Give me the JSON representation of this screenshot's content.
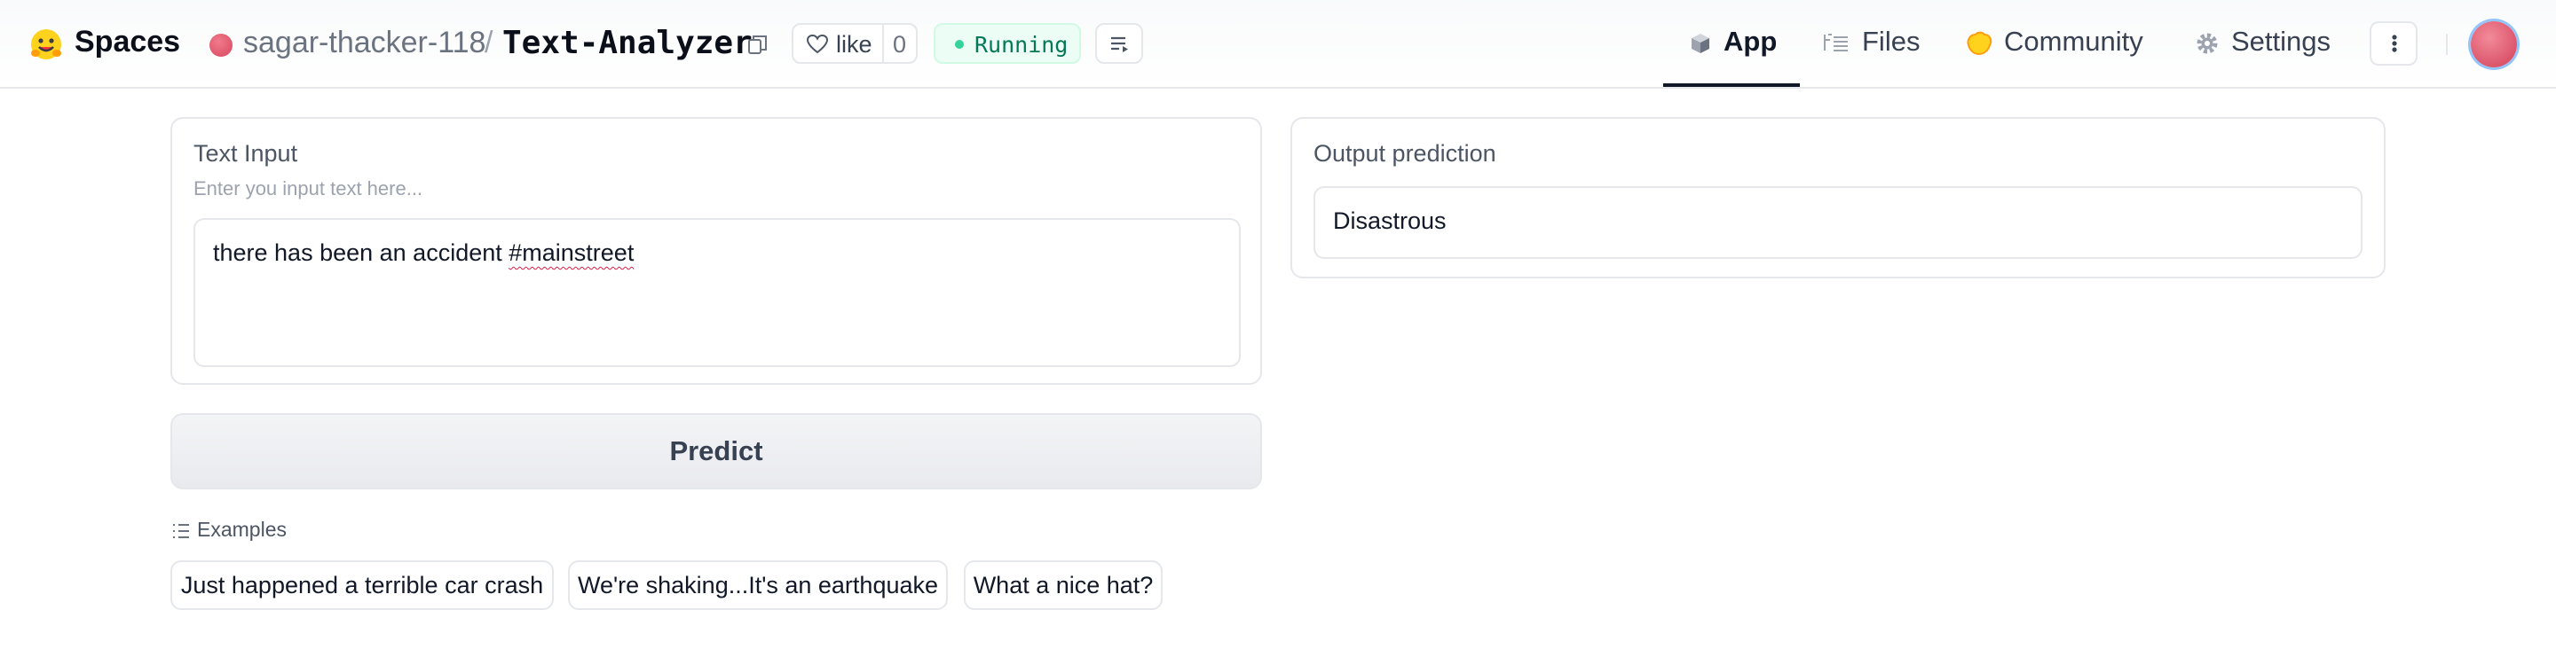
{
  "header": {
    "site_name": "Spaces",
    "owner": "sagar-thacker-118",
    "separator": "/",
    "repo": "Text-Analyzer",
    "like_label": "like",
    "like_count": "0",
    "status": "Running",
    "tabs": [
      {
        "label": "App",
        "icon": "cube-icon",
        "active": true
      },
      {
        "label": "Files",
        "icon": "files-icon",
        "active": false
      },
      {
        "label": "Community",
        "icon": "community-icon",
        "active": false
      },
      {
        "label": "Settings",
        "icon": "gear-icon",
        "active": false
      }
    ]
  },
  "input_panel": {
    "label": "Text Input",
    "placeholder_info": "Enter you input text here...",
    "value_prefix": "there has been an accident ",
    "value_hashtag": "#mainstreet"
  },
  "output_panel": {
    "label": "Output prediction",
    "value": "Disastrous"
  },
  "predict_label": "Predict",
  "examples": {
    "title": "Examples",
    "items": [
      "Just happened a terrible car crash",
      "We're shaking...It's an earthquake",
      "What a nice hat?"
    ]
  },
  "colors": {
    "status_green": "#047857",
    "accent_dark": "#111827"
  }
}
